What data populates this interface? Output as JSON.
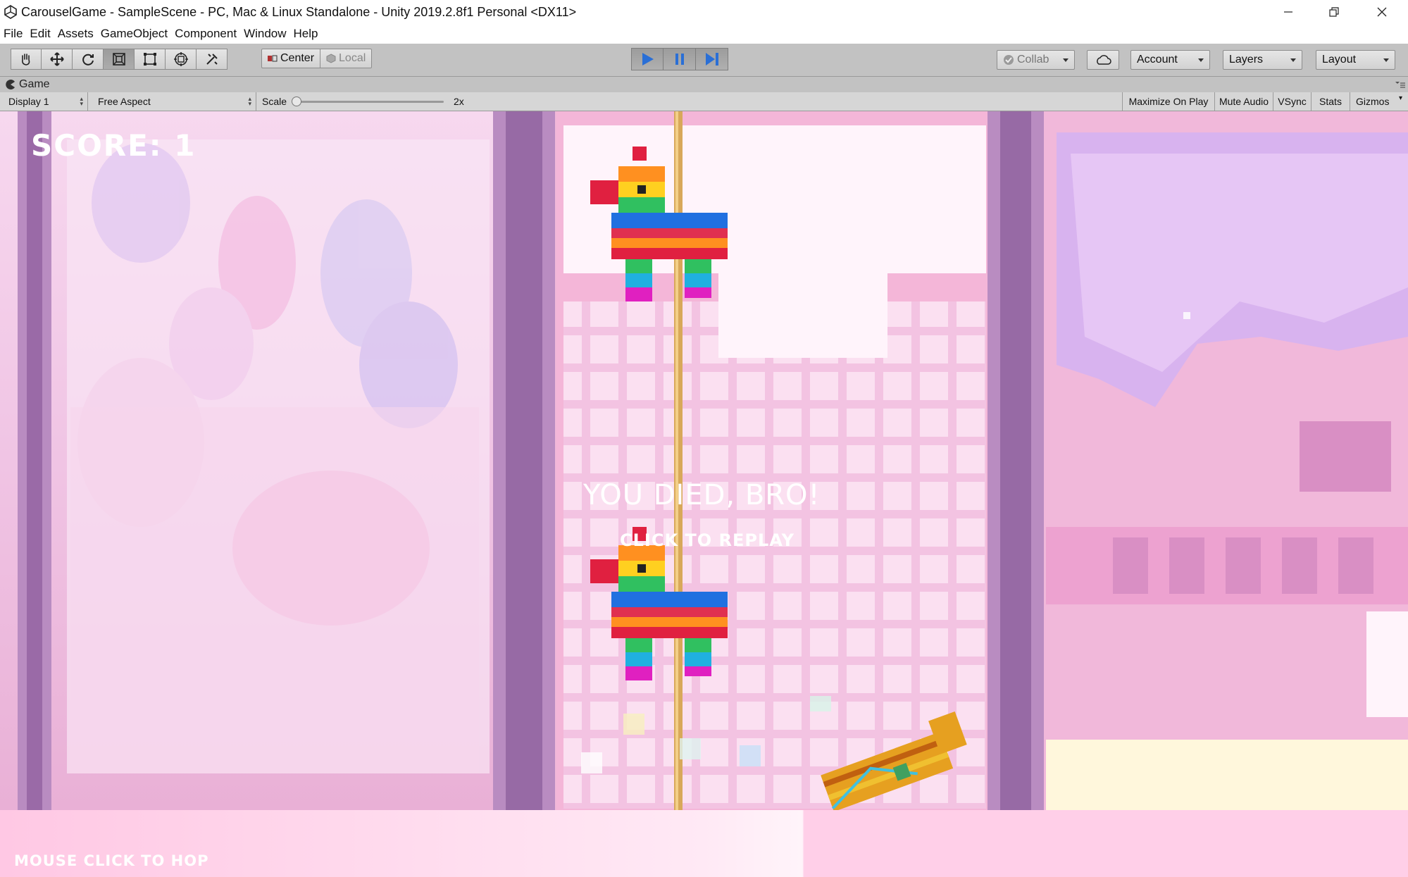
{
  "window": {
    "title": "CarouselGame - SampleScene - PC, Mac & Linux Standalone - Unity 2019.2.8f1 Personal <DX11>"
  },
  "menu": [
    "File",
    "Edit",
    "Assets",
    "GameObject",
    "Component",
    "Window",
    "Help"
  ],
  "toolbar": {
    "tools": [
      "hand-tool-icon",
      "move-tool-icon",
      "rotate-tool-icon",
      "scale-tool-icon",
      "rect-tool-icon",
      "transform-tool-icon",
      "custom-tool-icon"
    ],
    "pivot_label": "Center",
    "space_label": "Local",
    "collab_label": "Collab",
    "account_label": "Account",
    "layers_label": "Layers",
    "layout_label": "Layout",
    "colors": {
      "play_active": "#2a6fd6"
    }
  },
  "game_view": {
    "tab_label": "Game",
    "display": "Display 1",
    "aspect": "Free Aspect",
    "scale_label": "Scale",
    "scale_value": "2x",
    "maximize_label": "Maximize On Play",
    "mute_label": "Mute Audio",
    "vsync_label": "VSync",
    "stats_label": "Stats",
    "gizmos_label": "Gizmos"
  },
  "game": {
    "score": "SCORE: 1",
    "died_text": "YOU DIED, BRO!",
    "replay_text": "CLICK TO REPLAY",
    "hint_text": "MOUSE CLICK TO HOP",
    "colors": {
      "ui_text": "#ffffff",
      "ground": "#ffd8ec",
      "pole": "#d8a85a"
    }
  }
}
